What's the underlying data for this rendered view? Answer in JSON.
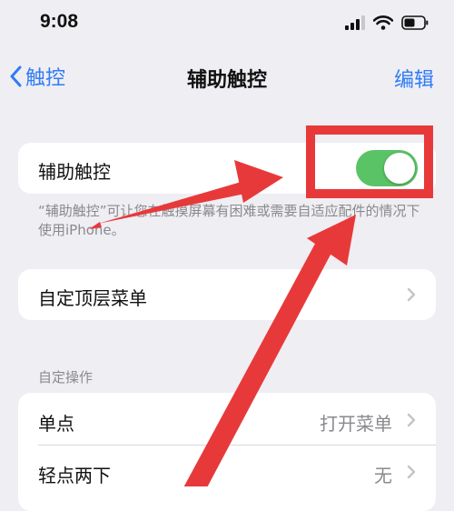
{
  "status_bar": {
    "time": "9:08"
  },
  "nav": {
    "back_label": "触控",
    "title": "辅助触控",
    "edit_label": "编辑"
  },
  "assistive_touch": {
    "label": "辅助触控",
    "enabled": true,
    "footnote": "“辅助触控”可让您在触摸屏幕有困难或需要自适应配件的情况下使用iPhone。"
  },
  "top_menu": {
    "label": "自定顶层菜单"
  },
  "custom_actions": {
    "header": "自定操作",
    "items": [
      {
        "label": "单点",
        "value": "打开菜单"
      },
      {
        "label": "轻点两下",
        "value": "无"
      }
    ]
  },
  "colors": {
    "accent": "#2f7cf6",
    "toggle_on": "#5ac366",
    "annotation_red": "#e8393a"
  }
}
